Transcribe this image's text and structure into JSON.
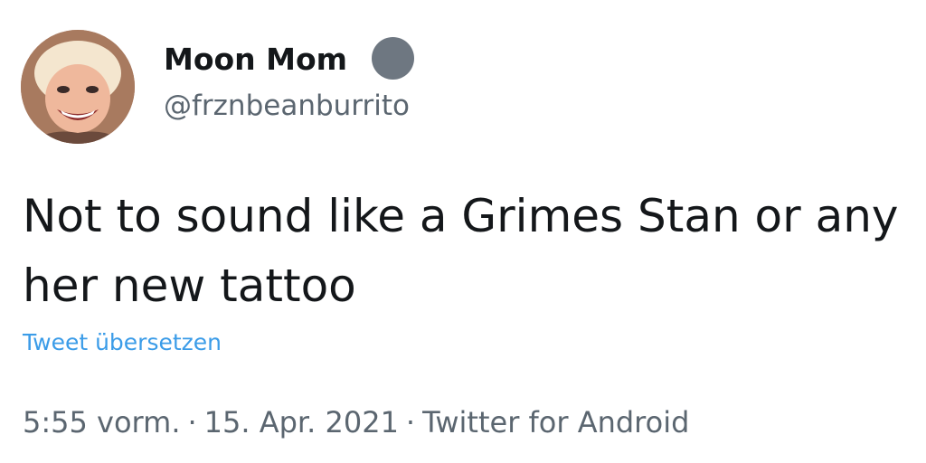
{
  "author": {
    "display_name": "Moon Mom",
    "handle": "@frznbeanburrito",
    "badge_icon": "verified-badge-icon"
  },
  "tweet": {
    "text_lines": [
      "Not to sound like a Grimes Stan or any",
      "her new tattoo"
    ],
    "translate_label": "Tweet übersetzen"
  },
  "meta": {
    "time": "5:55 vorm.",
    "separator": "·",
    "date": "15. Apr. 2021",
    "source": "Twitter for Android"
  },
  "colors": {
    "text": "#14171a",
    "secondary_text": "#5b6670",
    "link": "#3b9ce8",
    "badge": "#6e7781"
  }
}
